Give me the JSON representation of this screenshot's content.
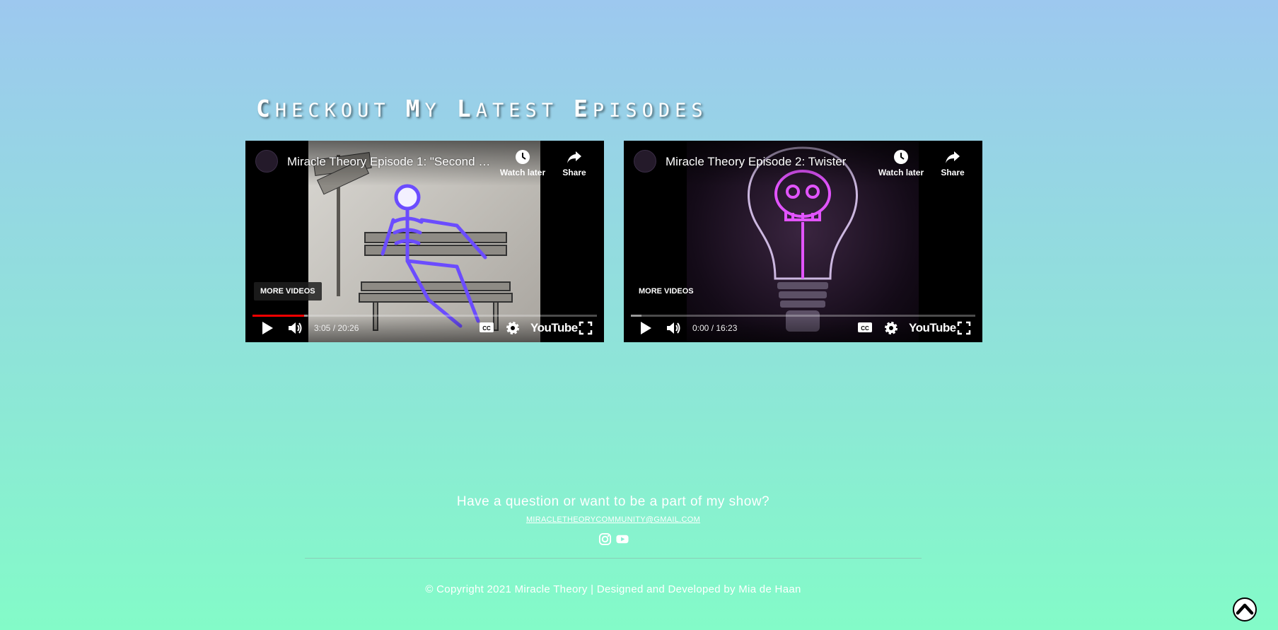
{
  "section": {
    "title_words": [
      {
        "cap": "C",
        "rest": "HECKOUT"
      },
      {
        "cap": "M",
        "rest": "Y"
      },
      {
        "cap": "L",
        "rest": "ATEST"
      },
      {
        "cap": "E",
        "rest": "PISODES"
      }
    ]
  },
  "videos": [
    {
      "title": "Miracle Theory Episode 1: \"Second C...",
      "watch_later": "Watch later",
      "share": "Share",
      "more_videos": "MORE VIDEOS",
      "time": "3:05 / 20:26",
      "progress": 0.15,
      "buffered": 0.16,
      "youtube": "YouTube"
    },
    {
      "title": "Miracle Theory Episode 2: Twister",
      "watch_later": "Watch later",
      "share": "Share",
      "more_videos": "MORE VIDEOS",
      "time": "0:00 / 16:23",
      "progress": 0.0,
      "buffered": 0.03,
      "youtube": "YouTube"
    }
  ],
  "footer": {
    "question": "Have a question or want to be a part of my show?",
    "email": "MIRACLETHEORYCOMMUNITY@GMAIL.COM",
    "socials": [
      "instagram-icon",
      "youtube-icon"
    ],
    "copyright": "© Copyright 2021 Miracle Theory | Designed and Developed by Mia de Haan"
  },
  "back_to_top_icon": "chevron-up-icon"
}
